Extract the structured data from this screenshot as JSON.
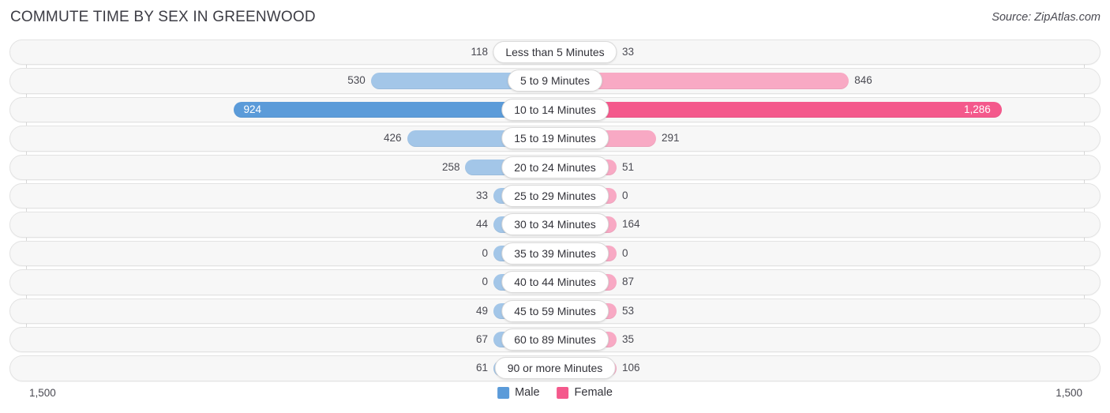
{
  "header": {
    "title": "COMMUTE TIME BY SEX IN GREENWOOD",
    "source": "Source: ZipAtlas.com"
  },
  "axis": {
    "left_label": "1,500",
    "right_label": "1,500"
  },
  "legend": {
    "items": [
      {
        "label": "Male",
        "color": "#5b9bd9"
      },
      {
        "label": "Female",
        "color": "#f4598c"
      }
    ]
  },
  "colors": {
    "male_light": "#a3c6e8",
    "male_dark": "#5b9bd9",
    "female_light": "#f8a9c4",
    "female_dark": "#f4598c",
    "track": "#f7f7f7",
    "track_border": "#e3e3e3"
  },
  "chart_data": {
    "type": "bar",
    "subtype": "diverging-butterfly",
    "title": "COMMUTE TIME BY SEX IN GREENWOOD",
    "xlabel": "",
    "ylabel": "",
    "xlim": [
      -1500,
      1500
    ],
    "axis_max": 1500,
    "grid": true,
    "legend_position": "bottom-center",
    "categories": [
      "Less than 5 Minutes",
      "5 to 9 Minutes",
      "10 to 14 Minutes",
      "15 to 19 Minutes",
      "20 to 24 Minutes",
      "25 to 29 Minutes",
      "30 to 34 Minutes",
      "35 to 39 Minutes",
      "40 to 44 Minutes",
      "45 to 59 Minutes",
      "60 to 89 Minutes",
      "90 or more Minutes"
    ],
    "series": [
      {
        "name": "Male",
        "side": "left",
        "values": [
          118,
          530,
          924,
          426,
          258,
          33,
          44,
          0,
          0,
          49,
          67,
          61
        ],
        "labels": [
          "118",
          "530",
          "924",
          "426",
          "258",
          "33",
          "44",
          "0",
          "0",
          "49",
          "67",
          "61"
        ]
      },
      {
        "name": "Female",
        "side": "right",
        "values": [
          33,
          846,
          1286,
          291,
          51,
          0,
          164,
          0,
          87,
          53,
          35,
          106
        ],
        "labels": [
          "33",
          "846",
          "1,286",
          "291",
          "51",
          "0",
          "164",
          "0",
          "87",
          "53",
          "35",
          "106"
        ]
      }
    ],
    "peak_row_index": 2
  },
  "rows": [
    {
      "label": "Less than 5 Minutes",
      "male": 118,
      "male_label": "118",
      "female": 33,
      "female_label": "33",
      "peak": false
    },
    {
      "label": "5 to 9 Minutes",
      "male": 530,
      "male_label": "530",
      "female": 846,
      "female_label": "846",
      "peak": false
    },
    {
      "label": "10 to 14 Minutes",
      "male": 924,
      "male_label": "924",
      "female": 1286,
      "female_label": "1,286",
      "peak": true
    },
    {
      "label": "15 to 19 Minutes",
      "male": 426,
      "male_label": "426",
      "female": 291,
      "female_label": "291",
      "peak": false
    },
    {
      "label": "20 to 24 Minutes",
      "male": 258,
      "male_label": "258",
      "female": 51,
      "female_label": "51",
      "peak": false
    },
    {
      "label": "25 to 29 Minutes",
      "male": 33,
      "male_label": "33",
      "female": 0,
      "female_label": "0",
      "peak": false
    },
    {
      "label": "30 to 34 Minutes",
      "male": 44,
      "male_label": "44",
      "female": 164,
      "female_label": "164",
      "peak": false
    },
    {
      "label": "35 to 39 Minutes",
      "male": 0,
      "male_label": "0",
      "female": 0,
      "female_label": "0",
      "peak": false
    },
    {
      "label": "40 to 44 Minutes",
      "male": 0,
      "male_label": "0",
      "female": 87,
      "female_label": "87",
      "peak": false
    },
    {
      "label": "45 to 59 Minutes",
      "male": 49,
      "male_label": "49",
      "female": 53,
      "female_label": "53",
      "peak": false
    },
    {
      "label": "60 to 89 Minutes",
      "male": 67,
      "male_label": "67",
      "female": 35,
      "female_label": "35",
      "peak": false
    },
    {
      "label": "90 or more Minutes",
      "male": 61,
      "male_label": "61",
      "female": 106,
      "female_label": "106",
      "peak": false
    }
  ]
}
